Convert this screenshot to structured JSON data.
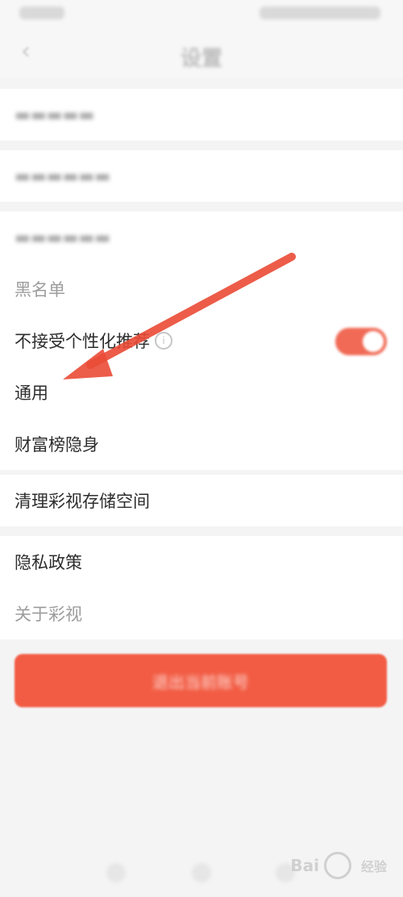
{
  "header": {
    "title": "设置"
  },
  "rows": {
    "blacklist": "黑名单",
    "no_personalized": "不接受个性化推荐",
    "info_glyph": "i",
    "general": "通用",
    "wealth_hide": "财富榜隐身",
    "clear_storage": "清理彩视存储空间",
    "privacy": "隐私政策",
    "about": "关于彩视"
  },
  "toggle_state": "on",
  "logout_label": "退出当前账号",
  "watermark": {
    "brand": "Bai",
    "sub": "经验"
  },
  "colors": {
    "accent": "#f25c44",
    "toggle_on": "#f06a55",
    "background": "#f4f4f4"
  }
}
